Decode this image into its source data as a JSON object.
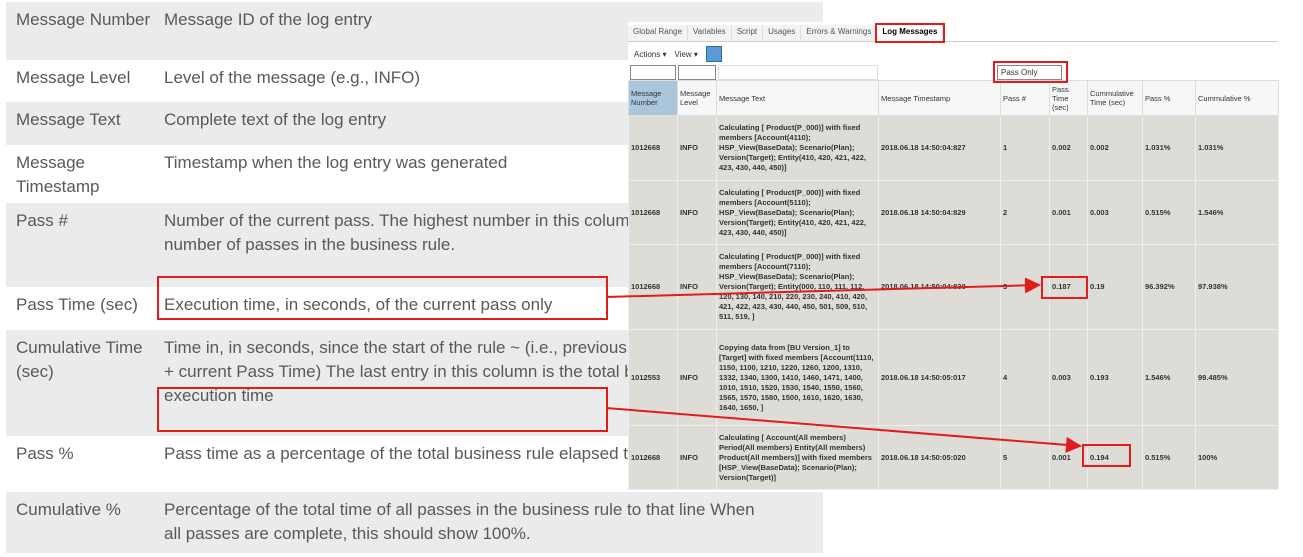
{
  "definitions": [
    {
      "term": "Message Number",
      "desc": "Message ID of the log entry"
    },
    {
      "term": "Message Level",
      "desc": "Level of the message (e.g., INFO)"
    },
    {
      "term": "Message Text",
      "desc": "Complete text of the log entry"
    },
    {
      "term": "Message Timestamp",
      "desc": "Timestamp when the log entry was generated"
    },
    {
      "term": "Pass #",
      "desc": "Number of the current pass.  The highest number in this column is the total number of passes in the business rule."
    },
    {
      "term": "Pass Time (sec)",
      "desc": "Execution time, in seconds, of the current pass only"
    },
    {
      "term": "Cumulative Time (sec)",
      "desc": "Time in, in seconds, since the start of the rule ~ (i.e., previous Cumulative Time + current Pass Time) The last entry in this column is the total business rule execution time"
    },
    {
      "term": "Pass %",
      "desc": "Pass time as a percentage of the total business rule elapsed time"
    },
    {
      "term": "Cumulative %",
      "desc": "Percentage of the total time of all passes in the business rule to that line When all passes are complete, this should show 100%."
    }
  ],
  "inset": {
    "tabs": [
      "Global Range",
      "Variables",
      "Script",
      "Usages",
      "Errors & Warnings",
      "Log Messages"
    ],
    "active_tab": "Log Messages",
    "toolbar": {
      "actions": "Actions ▾",
      "view": "View ▾",
      "export_icon": "export-icon"
    },
    "filter_value": "Pass Only",
    "columns": [
      "Message Number",
      "Message Level",
      "Message Text",
      "Message Timestamp",
      "Pass #",
      "Pass Time (sec)",
      "Cummulative Time (sec)",
      "Pass %",
      "Cummulative %"
    ],
    "rows": [
      [
        "1012668",
        "INFO",
        "Calculating [ Product(P_000)] with fixed members [Account(4110); HSP_View(BaseData); Scenario(Plan); Version(Target); Entity(410, 420, 421, 422, 423, 430, 440, 450)]",
        "2018.06.18 14:50:04:827",
        "1",
        "0.002",
        "0.002",
        "1.031%",
        "1.031%"
      ],
      [
        "1012668",
        "INFO",
        "Calculating [ Product(P_000)] with fixed members [Account(5110); HSP_View(BaseData); Scenario(Plan); Version(Target); Entity(410, 420, 421, 422, 423, 430, 440, 450)]",
        "2018.06.18 14:50:04:829",
        "2",
        "0.001",
        "0.003",
        "0.515%",
        "1.546%"
      ],
      [
        "1012668",
        "INFO",
        "Calculating [ Product(P_000)] with fixed members [Account(7110); HSP_View(BaseData); Scenario(Plan); Version(Target); Entity(000, 110, 111, 112, 120, 130, 140, 210, 220, 230, 240, 410, 420, 421, 422, 423, 430, 440, 450, 501, 509, 510, 511, 519, ]",
        "2018.06.18 14:50:04:830",
        "3",
        "0.187",
        "0.19",
        "96.392%",
        "97.938%"
      ],
      [
        "1012553",
        "INFO",
        "Copying data from [BU Version_1] to [Target] with fixed members [Account(1110, 1150, 1100, 1210, 1220, 1260, 1200, 1310, 1332, 1340, 1300, 1410, 1460, 1471, 1400, 1010, 1510, 1520, 1530, 1540, 1550, 1560, 1565, 1570, 1580, 1500, 1610, 1620, 1630, 1640, 1650, ]",
        "2018.06.18 14:50:05:017",
        "4",
        "0.003",
        "0.193",
        "1.546%",
        "99.485%"
      ],
      [
        "1012668",
        "INFO",
        "Calculating [ Account(All members) Period(All members) Entity(All members) Product(All members)] with fixed members [HSP_View(BaseData); Scenario(Plan); Version(Target)]",
        "2018.06.18 14:50:05:020",
        "5",
        "0.001",
        "0.194",
        "0.515%",
        "100%"
      ]
    ]
  },
  "colors": {
    "highlight": "#e21b1b",
    "row_bg": "#dedcd7",
    "alt_bg": "#e9ebec"
  }
}
